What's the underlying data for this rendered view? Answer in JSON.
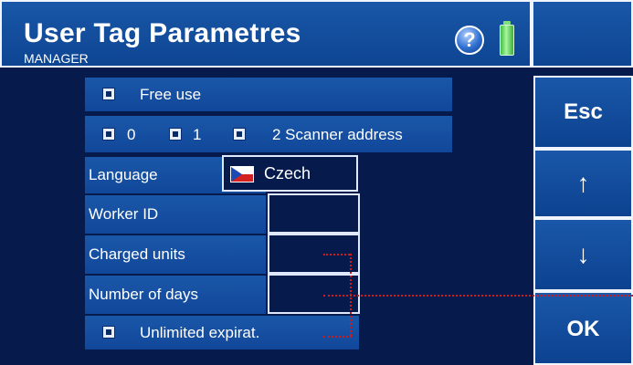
{
  "header": {
    "title": "User Tag Parametres",
    "subtitle": "MANAGER",
    "help_glyph": "?"
  },
  "side": {
    "esc": "Esc",
    "up": "↑",
    "down": "↓",
    "ok": "OK"
  },
  "form": {
    "free_use": "Free use",
    "scanner_options": [
      "0",
      "1",
      "2 Scanner address"
    ],
    "language_label": "Language",
    "language_value": "Czech",
    "worker_id_label": "Worker ID",
    "charged_units_label": "Charged units",
    "number_of_days_label": "Number of days",
    "unlimited_expiration": "Unlimited expirat."
  },
  "colors": {
    "background": "#061a4c",
    "panel": "#1a57a8",
    "annotation": "#d31a1a",
    "battery": "#3fbf3f"
  },
  "icons": {
    "help": "help-icon",
    "battery": "battery-icon",
    "language_flag": "czech-flag-icon"
  }
}
